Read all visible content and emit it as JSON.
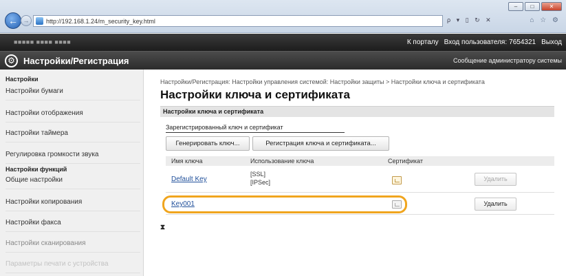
{
  "browser": {
    "url": "http://192.168.1.24/m_security_key.html",
    "window_buttons": [
      "‒",
      "□",
      "✕"
    ],
    "address_tools": "ρ ▾ ▯ ↻ ✕",
    "fav_icons": "⌂ ☆ ⚙"
  },
  "topbar": {
    "device_name": "■■■■■  ■■■■ ■■■■",
    "portal": "К порталу",
    "login_user_label": "Вход пользователя:",
    "login_user_value": "7654321",
    "logout": "Выход"
  },
  "header": {
    "title": "Настройки/Регистрация",
    "admin_message": "Сообщение администратору системы"
  },
  "sidebar": {
    "section1_title": "Настройки",
    "items1": [
      "Настройки бумаги",
      "Настройки отображения",
      "Настройки таймера",
      "Регулировка громкости звука"
    ],
    "section2_title": "Настройки функций",
    "items2": [
      "Общие настройки",
      "Настройки копирования",
      "Настройки факса",
      "Настройки сканирования",
      "Параметры печати с устройства"
    ]
  },
  "main": {
    "breadcrumb": "Настройки/Регистрация: Настройки управления системой: Настройки защиты > Настройки ключа и сертификата",
    "page_title": "Настройки ключа и сертификата",
    "section_title": "Настройки ключа и сертификата",
    "subsection_title": "Зарегистрированный ключ и сертификат",
    "buttons": {
      "generate": "Генерировать ключ...",
      "register": "Регистрация ключа и сертификата..."
    },
    "table": {
      "headers": [
        "Имя ключа",
        "Использование ключа",
        "Сертификат",
        ""
      ],
      "rows": [
        {
          "key_name": "Default Key",
          "usage_line1": "[SSL]",
          "usage_line2": "[IPSec]",
          "delete_label": "Удалить"
        },
        {
          "key_name": "Key001",
          "usage_line1": "",
          "usage_line2": "",
          "delete_label": "Удалить"
        }
      ]
    },
    "to_top_icon": "⧗"
  }
}
